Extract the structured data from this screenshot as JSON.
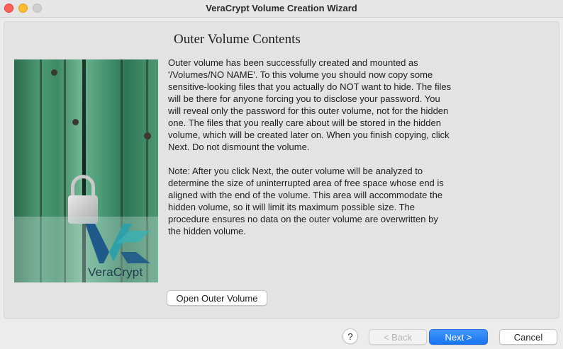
{
  "window": {
    "title": "VeraCrypt Volume Creation Wizard"
  },
  "page": {
    "heading": "Outer Volume Contents",
    "paragraphs": [
      "Outer volume has been successfully created and mounted as '/Volumes/NO NAME'. To this volume you should now copy some sensitive-looking files that you actually do NOT want to hide. The files will be there for anyone forcing you to disclose your password. You will reveal only the password for this outer volume, not for the hidden one. The files that you really care about will be stored in the hidden volume, which will be created later on. When you finish copying, click Next. Do not dismount the volume.",
      "Note: After you click Next, the outer volume will be analyzed to determine the size of uninterrupted area of free space whose end is aligned with the end of the volume. This area will accommodate the hidden volume, so it will limit its maximum possible size. The procedure ensures no data on the outer volume are overwritten by the hidden volume."
    ],
    "open_outer_label": "Open Outer Volume"
  },
  "sidebar_art": {
    "brand_text": "VeraCrypt",
    "icon": "padlock-on-green-wooden-door"
  },
  "footer": {
    "help_label": "?",
    "back_label": "< Back",
    "back_enabled": false,
    "next_label": "Next >",
    "cancel_label": "Cancel"
  },
  "colors": {
    "accent": "#1a75f0",
    "brand_blue": "#1f5a8a",
    "brand_teal": "#2fa0a8"
  }
}
